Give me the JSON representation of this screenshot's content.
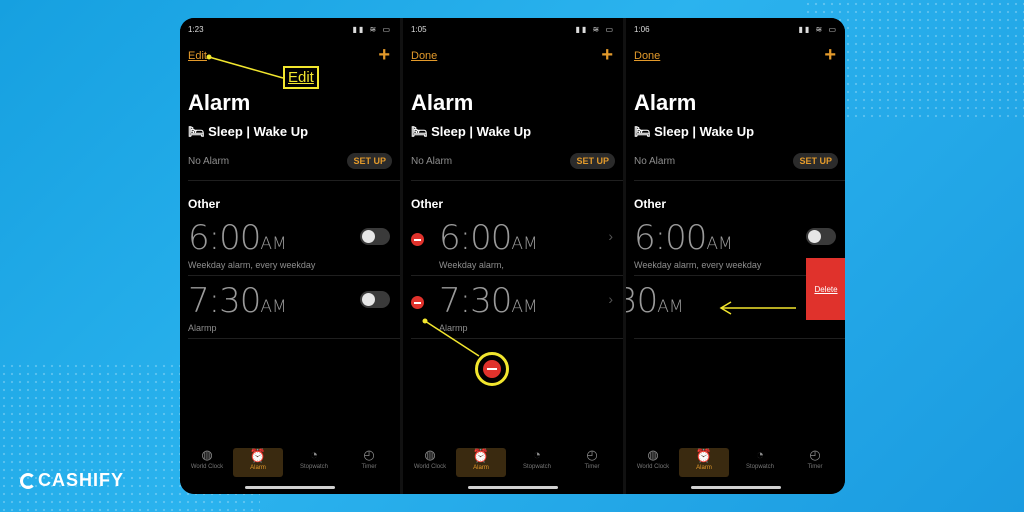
{
  "phones": [
    {
      "status_time": "1:23",
      "edit_label": "Edit",
      "title": "Alarm",
      "sleep": "🛏 Sleep | Wake Up",
      "no_alarm": "No Alarm",
      "setup": "SET UP",
      "other": "Other",
      "alarms": [
        {
          "time": "6:00",
          "ampm": "AM",
          "label": "Weekday alarm, every weekday"
        },
        {
          "time": "7:30",
          "ampm": "AM",
          "label": "Alarmp"
        }
      ],
      "callout": "Edit"
    },
    {
      "status_time": "1:05",
      "edit_label": "Done",
      "title": "Alarm",
      "sleep": "🛏 Sleep | Wake Up",
      "no_alarm": "No Alarm",
      "setup": "SET UP",
      "other": "Other",
      "alarms": [
        {
          "time": "6:00",
          "ampm": "AM",
          "label": "Weekday alarm,"
        },
        {
          "time": "7:30",
          "ampm": "AM",
          "label": "Alarmp"
        }
      ]
    },
    {
      "status_time": "1:06",
      "edit_label": "Done",
      "title": "Alarm",
      "sleep": "🛏 Sleep | Wake Up",
      "no_alarm": "No Alarm",
      "setup": "SET UP",
      "other": "Other",
      "alarms": [
        {
          "time": "6:00",
          "ampm": "AM",
          "label": "Weekday alarm, every weekday"
        },
        {
          "time": "30",
          "ampm": "AM",
          "label": ""
        }
      ],
      "delete_label": "Delete"
    }
  ],
  "tabs": [
    "World Clock",
    "Alarm",
    "Stopwatch",
    "Timer"
  ],
  "tab_icons": [
    "globe-icon",
    "alarm-clock-icon",
    "stopwatch-icon",
    "timer-icon"
  ],
  "brand": "CASHIFY",
  "colors": {
    "accent": "#e39a2b",
    "highlight": "#f2e62e",
    "delete": "#e0322c",
    "background": "#1ea6e6"
  }
}
